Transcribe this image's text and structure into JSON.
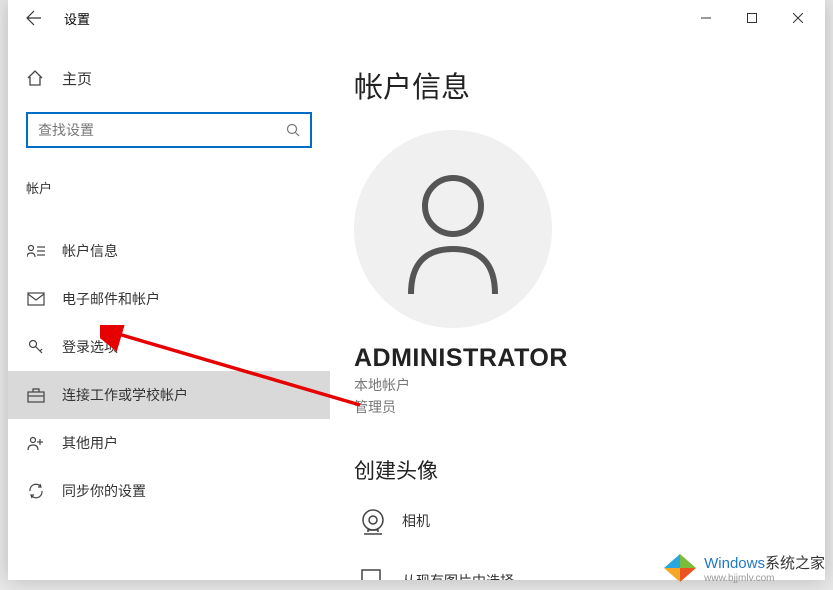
{
  "window": {
    "title": "设置"
  },
  "sidebar": {
    "home_label": "主页",
    "search_placeholder": "查找设置",
    "section": "帐户",
    "items": [
      {
        "label": "帐户信息"
      },
      {
        "label": "电子邮件和帐户"
      },
      {
        "label": "登录选项"
      },
      {
        "label": "连接工作或学校帐户"
      },
      {
        "label": "其他用户"
      },
      {
        "label": "同步你的设置"
      }
    ]
  },
  "main": {
    "heading": "帐户信息",
    "username": "ADMINISTRATOR",
    "account_type": "本地帐户",
    "role": "管理员",
    "create_avatar": "创建头像",
    "options": [
      {
        "label": "相机"
      },
      {
        "label": "从现有图片中选择"
      }
    ]
  },
  "watermark": {
    "main": "Windows",
    "brand": "系统之家",
    "sub": "www.bjjmlv.com"
  }
}
